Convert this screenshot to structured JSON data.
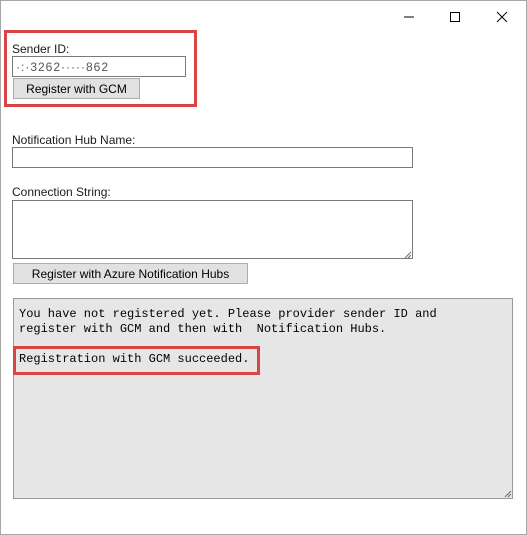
{
  "window": {
    "minimize_icon": "minimize-icon",
    "maximize_icon": "maximize-icon",
    "close_icon": "close-icon"
  },
  "sender": {
    "label": "Sender ID:",
    "value": "·:·3262·····862",
    "register_button": "Register with GCM"
  },
  "hub": {
    "name_label": "Notification Hub Name:",
    "name_value": "",
    "connection_label": "Connection String:",
    "connection_value": "",
    "register_button": "Register with Azure Notification Hubs"
  },
  "output": {
    "line1": "You have not registered yet. Please provider sender ID and",
    "line2": "register with GCM and then with  Notification Hubs.",
    "line3": "Registration with GCM succeeded."
  },
  "colors": {
    "highlight": "#d94545",
    "output_bg": "#e6e6e6",
    "button_bg": "#e1e1e1"
  }
}
